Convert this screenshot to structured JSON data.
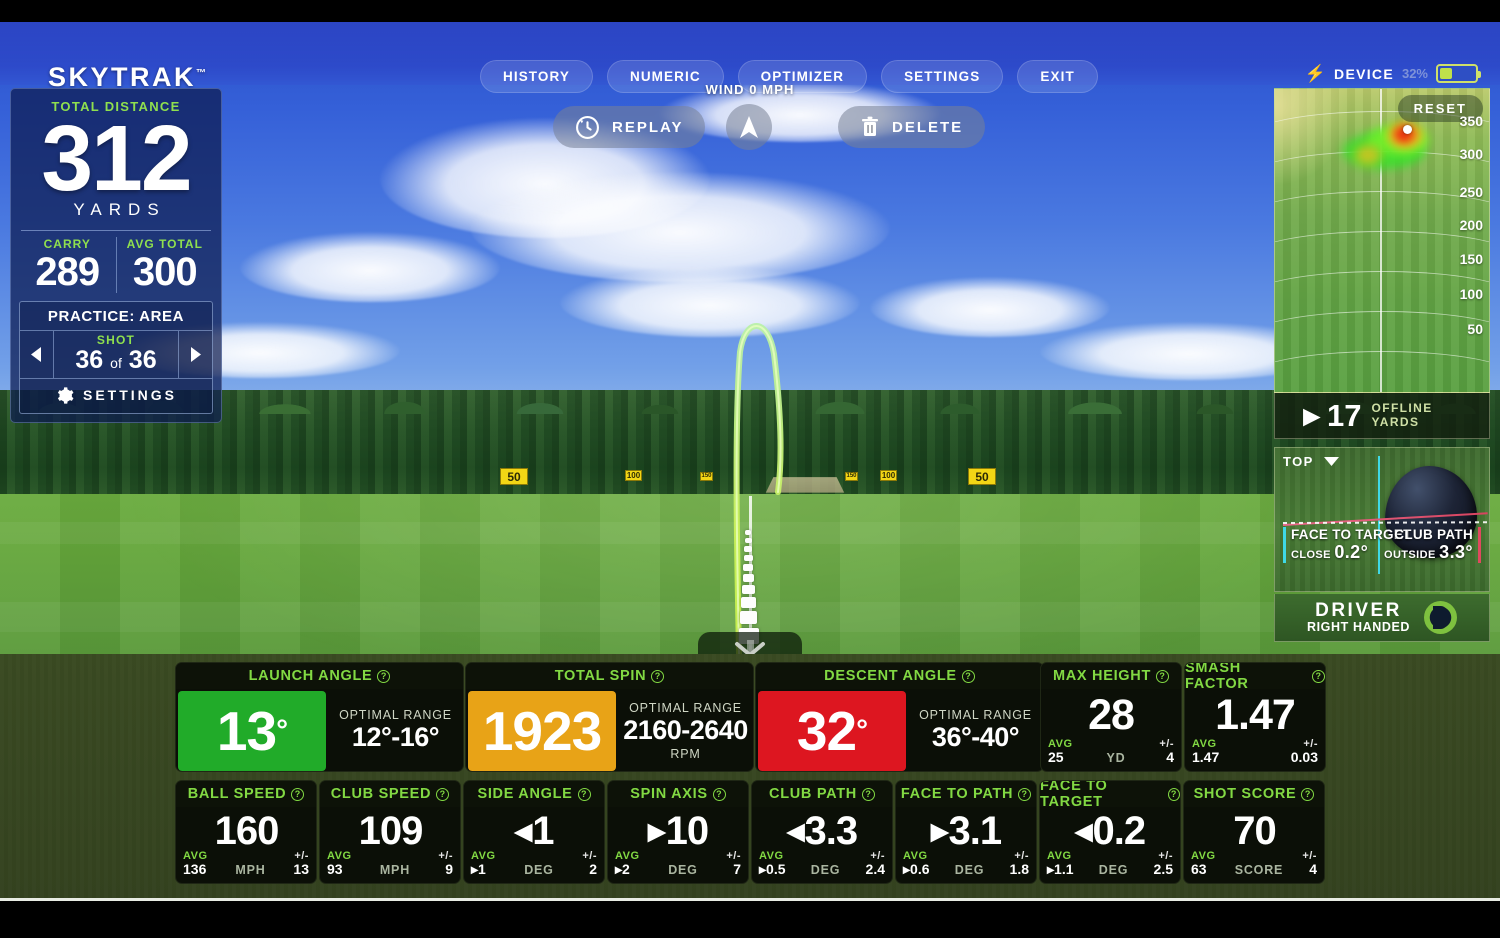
{
  "app": {
    "logo": "SKYTRAK",
    "logo_tm": "™"
  },
  "topnav": {
    "items": [
      {
        "label": "HISTORY"
      },
      {
        "label": "NUMERIC"
      },
      {
        "label": "OPTIMIZER"
      },
      {
        "label": "SETTINGS"
      },
      {
        "label": "EXIT"
      }
    ],
    "device_label": "DEVICE",
    "battery_pct": "32%",
    "battery_level": 32,
    "bolt_icon": "bolt-icon"
  },
  "shot_panel": {
    "total_distance_label": "TOTAL DISTANCE",
    "total_distance": "312",
    "units": "YARDS",
    "carry_label": "CARRY",
    "carry": "289",
    "avg_total_label": "AVG TOTAL",
    "avg_total": "300",
    "practice_label": "PRACTICE: AREA",
    "shot_label": "SHOT",
    "shot_current": "36",
    "shot_of": "of",
    "shot_total": "36",
    "prev_icon": "chevron-left-icon",
    "next_icon": "chevron-right-icon",
    "settings_label": "SETTINGS",
    "settings_icon": "gear-icon"
  },
  "center_controls": {
    "wind": "WIND 0 MPH",
    "replay_label": "REPLAY",
    "replay_icon": "replay-icon",
    "delete_label": "DELETE",
    "delete_icon": "trash-icon",
    "wind_dial_icon": "navigation-arrow-icon"
  },
  "dispersion": {
    "reset_label": "RESET",
    "ticks": [
      "350",
      "300",
      "250",
      "200",
      "150",
      "100",
      "50"
    ],
    "offline_value": "17",
    "offline_label_line1": "OFFLINE",
    "offline_label_line2": "YARDS",
    "offline_arrow_icon": "arrow-right-icon"
  },
  "club_view": {
    "view_label": "TOP",
    "view_caret_icon": "chevron-down-icon",
    "face_to_target_label": "FACE TO TARGET",
    "face_to_target_dir": "CLOSE",
    "face_to_target_value": "0.2°",
    "club_path_label": "CLUB PATH",
    "club_path_dir": "OUTSIDE",
    "club_path_value": "3.3°",
    "club_name": "DRIVER",
    "handedness": "RIGHT HANDED",
    "brand_icon": "skytrak-logo-icon"
  },
  "range_scene": {
    "yard_markers": [
      "50",
      "50"
    ],
    "collapse_icon": "chevron-down-icon"
  },
  "stats": {
    "help_icon": "question-mark-icon",
    "optimal_range_label": "OPTIMAL RANGE",
    "primary": [
      {
        "name": "launch-angle",
        "title": "LAUNCH ANGLE",
        "value": "13",
        "degree": "°",
        "status_color": "#21ab29",
        "range_label": "OPTIMAL RANGE",
        "range_value": "12°-16°",
        "range_unit": ""
      },
      {
        "name": "total-spin",
        "title": "TOTAL SPIN",
        "value": "1923",
        "degree": "",
        "status_color": "#e8a317",
        "range_label": "OPTIMAL RANGE",
        "range_value": "2160-2640",
        "range_unit": "RPM"
      },
      {
        "name": "descent-angle",
        "title": "DESCENT ANGLE",
        "value": "32",
        "degree": "°",
        "status_color": "#dd1620",
        "range_label": "OPTIMAL RANGE",
        "range_value": "36°-40°",
        "range_unit": ""
      }
    ],
    "secondary": [
      {
        "name": "max-height",
        "title": "MAX HEIGHT",
        "arrow": "",
        "value": "28",
        "avg_label": "AVG",
        "avg_arrow": "",
        "avg": "25",
        "unit": "YD",
        "pm_label": "+/-",
        "pm": "4"
      },
      {
        "name": "smash-factor",
        "title": "SMASH FACTOR",
        "arrow": "",
        "value": "1.47",
        "avg_label": "AVG",
        "avg_arrow": "",
        "avg": "1.47",
        "unit": "",
        "pm_label": "+/-",
        "pm": "0.03"
      }
    ],
    "tertiary": [
      {
        "name": "ball-speed",
        "title": "BALL SPEED",
        "arrow": "",
        "value": "160",
        "avg_label": "AVG",
        "avg_arrow": "",
        "avg": "136",
        "unit": "MPH",
        "pm_label": "+/-",
        "pm": "13"
      },
      {
        "name": "club-speed",
        "title": "CLUB SPEED",
        "arrow": "",
        "value": "109",
        "avg_label": "AVG",
        "avg_arrow": "",
        "avg": "93",
        "unit": "MPH",
        "pm_label": "+/-",
        "pm": "9"
      },
      {
        "name": "side-angle",
        "title": "SIDE ANGLE",
        "arrow": "◀",
        "value": "1",
        "avg_label": "AVG",
        "avg_arrow": "▸",
        "avg": "1",
        "unit": "DEG",
        "pm_label": "+/-",
        "pm": "2"
      },
      {
        "name": "spin-axis",
        "title": "SPIN AXIS",
        "arrow": "▶",
        "value": "10",
        "avg_label": "AVG",
        "avg_arrow": "▸",
        "avg": "2",
        "unit": "DEG",
        "pm_label": "+/-",
        "pm": "7"
      },
      {
        "name": "club-path",
        "title": "CLUB PATH",
        "arrow": "◀",
        "value": "3.3",
        "avg_label": "AVG",
        "avg_arrow": "▸",
        "avg": "0.5",
        "unit": "DEG",
        "pm_label": "+/-",
        "pm": "2.4"
      },
      {
        "name": "face-to-path",
        "title": "FACE TO PATH",
        "arrow": "▶",
        "value": "3.1",
        "avg_label": "AVG",
        "avg_arrow": "▸",
        "avg": "0.6",
        "unit": "DEG",
        "pm_label": "+/-",
        "pm": "1.8"
      },
      {
        "name": "face-to-target",
        "title": "FACE TO TARGET",
        "arrow": "◀",
        "value": "0.2",
        "avg_label": "AVG",
        "avg_arrow": "▸",
        "avg": "1.1",
        "unit": "DEG",
        "pm_label": "+/-",
        "pm": "2.5"
      },
      {
        "name": "shot-score",
        "title": "SHOT SCORE",
        "arrow": "",
        "value": "70",
        "avg_label": "AVG",
        "avg_arrow": "",
        "avg": "63",
        "unit": "SCORE",
        "pm_label": "+/-",
        "pm": "4"
      }
    ]
  }
}
